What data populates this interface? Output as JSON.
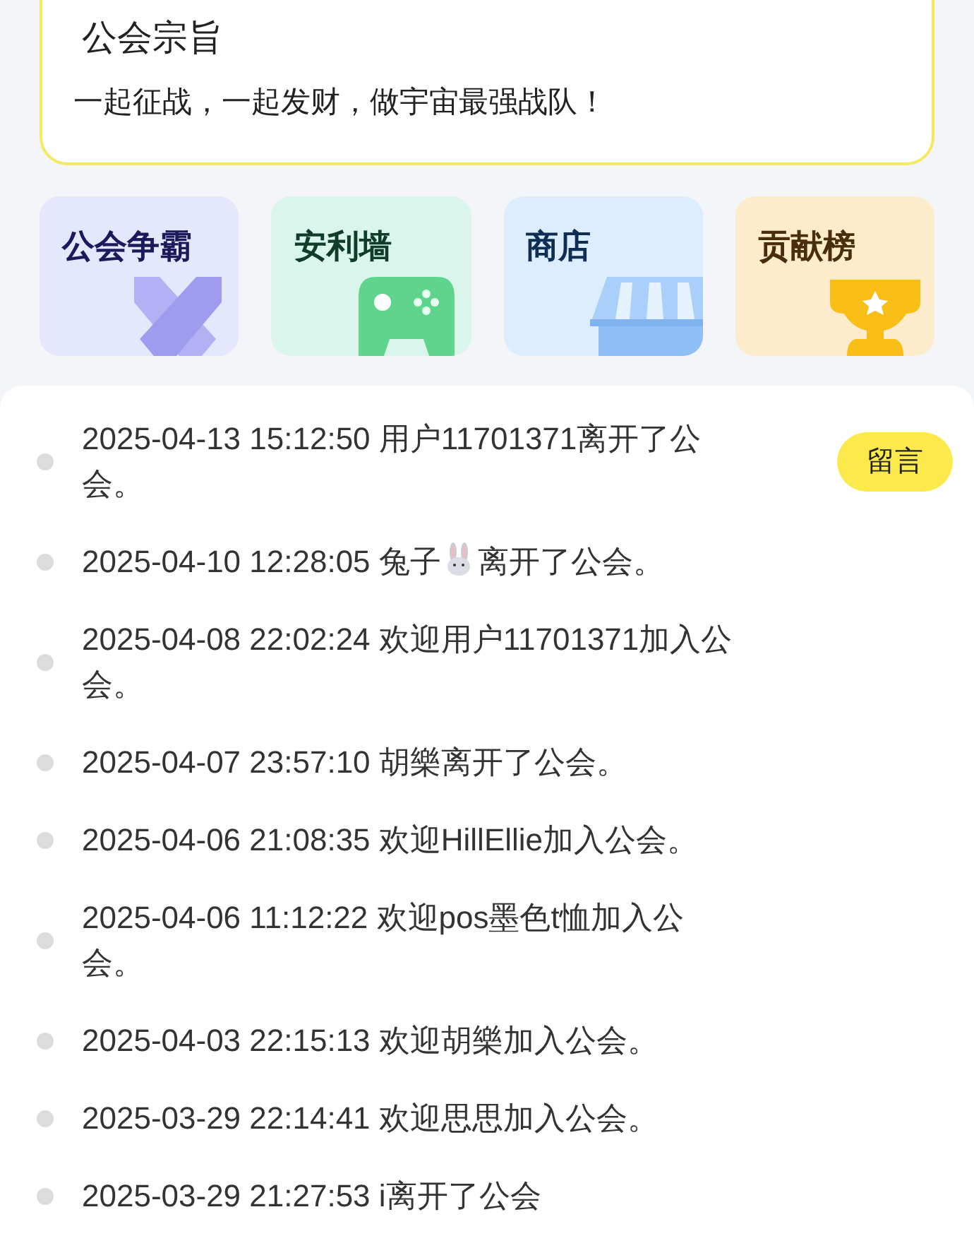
{
  "motto_card": {
    "title": "公会宗旨",
    "text": "一起征战，一起发财，做宇宙最强战队！"
  },
  "tiles": [
    {
      "title": "公会争霸",
      "kind": "swords"
    },
    {
      "title": "安利墙",
      "kind": "gamepad"
    },
    {
      "title": "商店",
      "kind": "shop"
    },
    {
      "title": "贡献榜",
      "kind": "trophy"
    }
  ],
  "message_button": "留言",
  "log": [
    {
      "time": "2025-04-13 15:12:50",
      "text": "用户11701371离开了公会。"
    },
    {
      "time": "2025-04-10 12:28:05",
      "kind": "with_icon",
      "text": "兔子",
      "text_after": "离开了公会。"
    },
    {
      "time": "2025-04-08 22:02:24",
      "text": "欢迎用户11701371加入公会。"
    },
    {
      "time": "2025-04-07 23:57:10",
      "text": "胡樂离开了公会。"
    },
    {
      "time": "2025-04-06 21:08:35",
      "text": "欢迎HillEllie加入公会。"
    },
    {
      "time": "2025-04-06 11:12:22",
      "text": "欢迎pos墨色t恤加入公会。"
    },
    {
      "time": "2025-04-03 22:15:13",
      "text": "欢迎胡樂加入公会。"
    },
    {
      "time": "2025-03-29 22:14:41",
      "text": "欢迎思思加入公会。"
    },
    {
      "time": "2025-03-29 21:27:53",
      "text": "i离开了公会"
    }
  ]
}
